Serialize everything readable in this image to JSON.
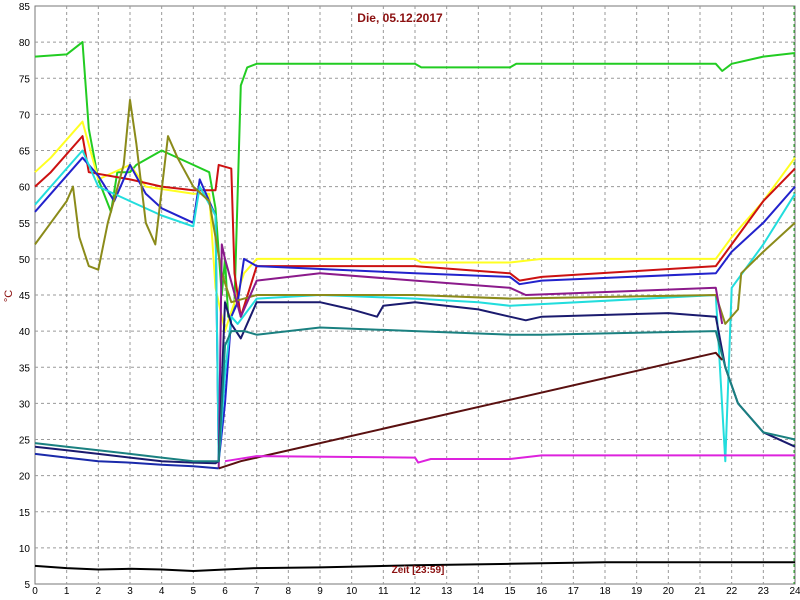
{
  "chart_data": {
    "type": "line",
    "title": "Die, 05.12.2017",
    "xlabel": "Zeit [23:59]",
    "ylabel": "°C",
    "xlim": [
      0,
      24
    ],
    "ylim": [
      5,
      85
    ],
    "xticks": [
      0,
      1,
      2,
      3,
      4,
      5,
      6,
      7,
      8,
      9,
      10,
      11,
      12,
      13,
      14,
      15,
      16,
      17,
      18,
      19,
      20,
      21,
      22,
      23,
      24
    ],
    "yticks": [
      5,
      10,
      15,
      20,
      25,
      30,
      35,
      40,
      45,
      50,
      55,
      60,
      65,
      70,
      75,
      80,
      85
    ],
    "grid": true,
    "background": "#ffffff",
    "grid_color": "#9a9a9a",
    "series": [
      {
        "color": "#22cc22",
        "width": 2,
        "points": [
          [
            0,
            78
          ],
          [
            1,
            78.3
          ],
          [
            1.5,
            80
          ],
          [
            1.7,
            68
          ],
          [
            2,
            61
          ],
          [
            2.4,
            56.5
          ],
          [
            2.6,
            62
          ],
          [
            3,
            62
          ],
          [
            3.2,
            63
          ],
          [
            4,
            65
          ],
          [
            5,
            63
          ],
          [
            5.5,
            62
          ],
          [
            5.7,
            57
          ],
          [
            5.9,
            45
          ],
          [
            6,
            50
          ],
          [
            6.1,
            42
          ],
          [
            6.2,
            42
          ],
          [
            6.3,
            44
          ],
          [
            6.5,
            74
          ],
          [
            6.7,
            76.5
          ],
          [
            7,
            77
          ],
          [
            12,
            77
          ],
          [
            12.2,
            76.5
          ],
          [
            15,
            76.5
          ],
          [
            15.2,
            77
          ],
          [
            21.5,
            77
          ],
          [
            21.7,
            76
          ],
          [
            22,
            77
          ],
          [
            23,
            78
          ],
          [
            24,
            78.5
          ]
        ]
      },
      {
        "color": "#ffff22",
        "width": 2,
        "points": [
          [
            0,
            62
          ],
          [
            0.5,
            64
          ],
          [
            1.5,
            69
          ],
          [
            2,
            61
          ],
          [
            3,
            63
          ],
          [
            3.5,
            60
          ],
          [
            5,
            59
          ],
          [
            5.5,
            59
          ],
          [
            5.7,
            46
          ],
          [
            6,
            40
          ],
          [
            6.3,
            44
          ],
          [
            6.6,
            48
          ],
          [
            7,
            50
          ],
          [
            12,
            50
          ],
          [
            12.2,
            49.5
          ],
          [
            15,
            49.5
          ],
          [
            16,
            50
          ],
          [
            21.5,
            50
          ],
          [
            22,
            53
          ],
          [
            23,
            58
          ],
          [
            24,
            64
          ]
        ]
      },
      {
        "color": "#cc1111",
        "width": 2,
        "points": [
          [
            0,
            60
          ],
          [
            0.5,
            62
          ],
          [
            1.5,
            67
          ],
          [
            1.7,
            62
          ],
          [
            3,
            61
          ],
          [
            4,
            60
          ],
          [
            5,
            59.5
          ],
          [
            5.7,
            59.5
          ],
          [
            5.8,
            63
          ],
          [
            6.2,
            62.5
          ],
          [
            6.3,
            48
          ],
          [
            6.5,
            42
          ],
          [
            7,
            49
          ],
          [
            12,
            49
          ],
          [
            15,
            48
          ],
          [
            15.3,
            47
          ],
          [
            16,
            47.5
          ],
          [
            21.5,
            49
          ],
          [
            22,
            52
          ],
          [
            23,
            58
          ],
          [
            24,
            62.5
          ]
        ]
      },
      {
        "color": "#2222cc",
        "width": 2,
        "points": [
          [
            0,
            56.5
          ],
          [
            0.5,
            59
          ],
          [
            1.5,
            64
          ],
          [
            2,
            61.5
          ],
          [
            2.5,
            58
          ],
          [
            3,
            63
          ],
          [
            3.5,
            59
          ],
          [
            4,
            57
          ],
          [
            5,
            55
          ],
          [
            5.2,
            61
          ],
          [
            5.7,
            56
          ],
          [
            5.8,
            22
          ],
          [
            6,
            30
          ],
          [
            6.2,
            42
          ],
          [
            6.4,
            44
          ],
          [
            6.6,
            50
          ],
          [
            7,
            49
          ],
          [
            12,
            48
          ],
          [
            15,
            47.5
          ],
          [
            15.3,
            46.5
          ],
          [
            16,
            47
          ],
          [
            21.5,
            48
          ],
          [
            22,
            51
          ],
          [
            23,
            55
          ],
          [
            24,
            60
          ]
        ]
      },
      {
        "color": "#22dddd",
        "width": 2,
        "points": [
          [
            0,
            57.5
          ],
          [
            0.5,
            60
          ],
          [
            1.5,
            65
          ],
          [
            2,
            60
          ],
          [
            3,
            58
          ],
          [
            4,
            56
          ],
          [
            5,
            54.5
          ],
          [
            5.2,
            60
          ],
          [
            5.7,
            56
          ],
          [
            5.8,
            22
          ],
          [
            6,
            34
          ],
          [
            6.2,
            42
          ],
          [
            6.4,
            41
          ],
          [
            7,
            44.5
          ],
          [
            9,
            45
          ],
          [
            12,
            44.5
          ],
          [
            14,
            44
          ],
          [
            15,
            43.5
          ],
          [
            21.5,
            45
          ],
          [
            21.8,
            22
          ],
          [
            22,
            46
          ],
          [
            23,
            52
          ],
          [
            24,
            59
          ]
        ]
      },
      {
        "color": "#8b8b1a",
        "width": 2,
        "points": [
          [
            0,
            52
          ],
          [
            0.5,
            55
          ],
          [
            1,
            58
          ],
          [
            1.2,
            60
          ],
          [
            1.4,
            53
          ],
          [
            1.7,
            49
          ],
          [
            2,
            48.5
          ],
          [
            2.3,
            55
          ],
          [
            2.8,
            63
          ],
          [
            3,
            72
          ],
          [
            3.2,
            66
          ],
          [
            3.5,
            55
          ],
          [
            3.8,
            52
          ],
          [
            4.2,
            67
          ],
          [
            4.5,
            64
          ],
          [
            5,
            60
          ],
          [
            5.5,
            58
          ],
          [
            5.9,
            48
          ],
          [
            6.2,
            44
          ],
          [
            7,
            45
          ],
          [
            12,
            45
          ],
          [
            15,
            44.5
          ],
          [
            21.5,
            45
          ],
          [
            21.8,
            41
          ],
          [
            22.2,
            43
          ],
          [
            22.3,
            48
          ],
          [
            23,
            51
          ],
          [
            24,
            55
          ]
        ]
      },
      {
        "color": "#8b1a8b",
        "width": 2,
        "points": [
          [
            5.8,
            21
          ],
          [
            5.9,
            52
          ],
          [
            6,
            50
          ],
          [
            6.5,
            42
          ],
          [
            7,
            47
          ],
          [
            9,
            48
          ],
          [
            12,
            47
          ],
          [
            15,
            46
          ],
          [
            15.5,
            45
          ],
          [
            21.5,
            46
          ],
          [
            21.7,
            41
          ]
        ]
      },
      {
        "color": "#1a1a6e",
        "width": 2,
        "points": [
          [
            0,
            24
          ],
          [
            1,
            23.5
          ],
          [
            2,
            23
          ],
          [
            3,
            22.5
          ],
          [
            4,
            22
          ],
          [
            5,
            21.8
          ],
          [
            5.7,
            21.7
          ],
          [
            5.8,
            22
          ],
          [
            6,
            44
          ],
          [
            6.2,
            41
          ],
          [
            6.5,
            39
          ],
          [
            6.8,
            42
          ],
          [
            7,
            44
          ],
          [
            9,
            44
          ],
          [
            10,
            43
          ],
          [
            10.8,
            42
          ],
          [
            11,
            43.5
          ],
          [
            12,
            44
          ],
          [
            14,
            43
          ],
          [
            15,
            42
          ],
          [
            15.5,
            41.5
          ],
          [
            16,
            42
          ],
          [
            20,
            42.5
          ],
          [
            21.5,
            42
          ],
          [
            21.8,
            35
          ],
          [
            22.2,
            30
          ],
          [
            23,
            26
          ],
          [
            24,
            24
          ]
        ]
      },
      {
        "color": "#1a8080",
        "width": 2,
        "points": [
          [
            0,
            24.5
          ],
          [
            1,
            24
          ],
          [
            2,
            23.5
          ],
          [
            3,
            23
          ],
          [
            4,
            22.5
          ],
          [
            5,
            22
          ],
          [
            5.8,
            22
          ],
          [
            6,
            38
          ],
          [
            6.2,
            40
          ],
          [
            6.6,
            40
          ],
          [
            7,
            39.5
          ],
          [
            8,
            40
          ],
          [
            9,
            40.5
          ],
          [
            12,
            40
          ],
          [
            15,
            39.5
          ],
          [
            16,
            39.5
          ],
          [
            21.5,
            40
          ],
          [
            21.8,
            35
          ],
          [
            22.2,
            30
          ],
          [
            23,
            26
          ],
          [
            24,
            25
          ]
        ]
      },
      {
        "color": "#5a1010",
        "width": 2,
        "points": [
          [
            5.8,
            21
          ],
          [
            6.5,
            22
          ],
          [
            21.5,
            37
          ],
          [
            21.7,
            36
          ]
        ]
      },
      {
        "color": "#dd22dd",
        "width": 2,
        "points": [
          [
            6,
            22
          ],
          [
            7,
            22.7
          ],
          [
            12,
            22.5
          ],
          [
            12.1,
            21.8
          ],
          [
            12.5,
            22.3
          ],
          [
            15,
            22.3
          ],
          [
            16,
            22.8
          ],
          [
            24,
            22.8
          ]
        ]
      },
      {
        "color": "#000000",
        "width": 2,
        "points": [
          [
            0,
            7.5
          ],
          [
            1,
            7.2
          ],
          [
            2,
            7
          ],
          [
            3,
            7.1
          ],
          [
            4,
            7
          ],
          [
            5,
            6.8
          ],
          [
            6,
            7
          ],
          [
            7,
            7.2
          ],
          [
            9,
            7.3
          ],
          [
            12,
            7.6
          ],
          [
            15,
            7.8
          ],
          [
            18,
            8
          ],
          [
            21,
            8
          ],
          [
            24,
            8
          ]
        ]
      },
      {
        "color": "#1a2aaa",
        "width": 2,
        "points": [
          [
            0,
            23
          ],
          [
            1,
            22.5
          ],
          [
            2,
            22
          ],
          [
            3,
            21.8
          ],
          [
            4,
            21.5
          ],
          [
            5,
            21.3
          ],
          [
            5.8,
            21
          ]
        ]
      }
    ]
  }
}
